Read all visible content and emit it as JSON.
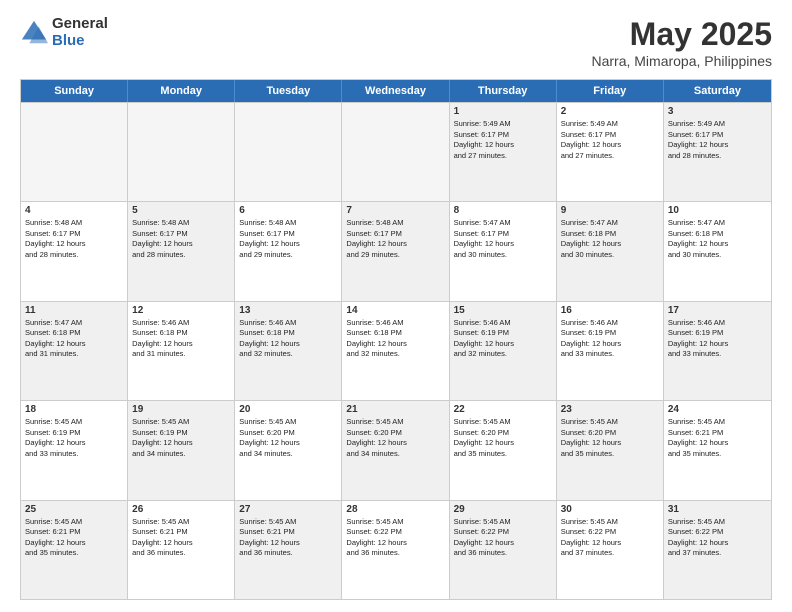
{
  "logo": {
    "general": "General",
    "blue": "Blue"
  },
  "title": "May 2025",
  "subtitle": "Narra, Mimaropa, Philippines",
  "headers": [
    "Sunday",
    "Monday",
    "Tuesday",
    "Wednesday",
    "Thursday",
    "Friday",
    "Saturday"
  ],
  "weeks": [
    [
      {
        "day": "",
        "info": "",
        "empty": true
      },
      {
        "day": "",
        "info": "",
        "empty": true
      },
      {
        "day": "",
        "info": "",
        "empty": true
      },
      {
        "day": "",
        "info": "",
        "empty": true
      },
      {
        "day": "1",
        "info": "Sunrise: 5:49 AM\nSunset: 6:17 PM\nDaylight: 12 hours\nand 27 minutes.",
        "empty": false
      },
      {
        "day": "2",
        "info": "Sunrise: 5:49 AM\nSunset: 6:17 PM\nDaylight: 12 hours\nand 27 minutes.",
        "empty": false
      },
      {
        "day": "3",
        "info": "Sunrise: 5:49 AM\nSunset: 6:17 PM\nDaylight: 12 hours\nand 28 minutes.",
        "empty": false
      }
    ],
    [
      {
        "day": "4",
        "info": "Sunrise: 5:48 AM\nSunset: 6:17 PM\nDaylight: 12 hours\nand 28 minutes.",
        "empty": false
      },
      {
        "day": "5",
        "info": "Sunrise: 5:48 AM\nSunset: 6:17 PM\nDaylight: 12 hours\nand 28 minutes.",
        "empty": false
      },
      {
        "day": "6",
        "info": "Sunrise: 5:48 AM\nSunset: 6:17 PM\nDaylight: 12 hours\nand 29 minutes.",
        "empty": false
      },
      {
        "day": "7",
        "info": "Sunrise: 5:48 AM\nSunset: 6:17 PM\nDaylight: 12 hours\nand 29 minutes.",
        "empty": false
      },
      {
        "day": "8",
        "info": "Sunrise: 5:47 AM\nSunset: 6:17 PM\nDaylight: 12 hours\nand 30 minutes.",
        "empty": false
      },
      {
        "day": "9",
        "info": "Sunrise: 5:47 AM\nSunset: 6:18 PM\nDaylight: 12 hours\nand 30 minutes.",
        "empty": false
      },
      {
        "day": "10",
        "info": "Sunrise: 5:47 AM\nSunset: 6:18 PM\nDaylight: 12 hours\nand 30 minutes.",
        "empty": false
      }
    ],
    [
      {
        "day": "11",
        "info": "Sunrise: 5:47 AM\nSunset: 6:18 PM\nDaylight: 12 hours\nand 31 minutes.",
        "empty": false
      },
      {
        "day": "12",
        "info": "Sunrise: 5:46 AM\nSunset: 6:18 PM\nDaylight: 12 hours\nand 31 minutes.",
        "empty": false
      },
      {
        "day": "13",
        "info": "Sunrise: 5:46 AM\nSunset: 6:18 PM\nDaylight: 12 hours\nand 32 minutes.",
        "empty": false
      },
      {
        "day": "14",
        "info": "Sunrise: 5:46 AM\nSunset: 6:18 PM\nDaylight: 12 hours\nand 32 minutes.",
        "empty": false
      },
      {
        "day": "15",
        "info": "Sunrise: 5:46 AM\nSunset: 6:19 PM\nDaylight: 12 hours\nand 32 minutes.",
        "empty": false
      },
      {
        "day": "16",
        "info": "Sunrise: 5:46 AM\nSunset: 6:19 PM\nDaylight: 12 hours\nand 33 minutes.",
        "empty": false
      },
      {
        "day": "17",
        "info": "Sunrise: 5:46 AM\nSunset: 6:19 PM\nDaylight: 12 hours\nand 33 minutes.",
        "empty": false
      }
    ],
    [
      {
        "day": "18",
        "info": "Sunrise: 5:45 AM\nSunset: 6:19 PM\nDaylight: 12 hours\nand 33 minutes.",
        "empty": false
      },
      {
        "day": "19",
        "info": "Sunrise: 5:45 AM\nSunset: 6:19 PM\nDaylight: 12 hours\nand 34 minutes.",
        "empty": false
      },
      {
        "day": "20",
        "info": "Sunrise: 5:45 AM\nSunset: 6:20 PM\nDaylight: 12 hours\nand 34 minutes.",
        "empty": false
      },
      {
        "day": "21",
        "info": "Sunrise: 5:45 AM\nSunset: 6:20 PM\nDaylight: 12 hours\nand 34 minutes.",
        "empty": false
      },
      {
        "day": "22",
        "info": "Sunrise: 5:45 AM\nSunset: 6:20 PM\nDaylight: 12 hours\nand 35 minutes.",
        "empty": false
      },
      {
        "day": "23",
        "info": "Sunrise: 5:45 AM\nSunset: 6:20 PM\nDaylight: 12 hours\nand 35 minutes.",
        "empty": false
      },
      {
        "day": "24",
        "info": "Sunrise: 5:45 AM\nSunset: 6:21 PM\nDaylight: 12 hours\nand 35 minutes.",
        "empty": false
      }
    ],
    [
      {
        "day": "25",
        "info": "Sunrise: 5:45 AM\nSunset: 6:21 PM\nDaylight: 12 hours\nand 35 minutes.",
        "empty": false
      },
      {
        "day": "26",
        "info": "Sunrise: 5:45 AM\nSunset: 6:21 PM\nDaylight: 12 hours\nand 36 minutes.",
        "empty": false
      },
      {
        "day": "27",
        "info": "Sunrise: 5:45 AM\nSunset: 6:21 PM\nDaylight: 12 hours\nand 36 minutes.",
        "empty": false
      },
      {
        "day": "28",
        "info": "Sunrise: 5:45 AM\nSunset: 6:22 PM\nDaylight: 12 hours\nand 36 minutes.",
        "empty": false
      },
      {
        "day": "29",
        "info": "Sunrise: 5:45 AM\nSunset: 6:22 PM\nDaylight: 12 hours\nand 36 minutes.",
        "empty": false
      },
      {
        "day": "30",
        "info": "Sunrise: 5:45 AM\nSunset: 6:22 PM\nDaylight: 12 hours\nand 37 minutes.",
        "empty": false
      },
      {
        "day": "31",
        "info": "Sunrise: 5:45 AM\nSunset: 6:22 PM\nDaylight: 12 hours\nand 37 minutes.",
        "empty": false
      }
    ]
  ]
}
